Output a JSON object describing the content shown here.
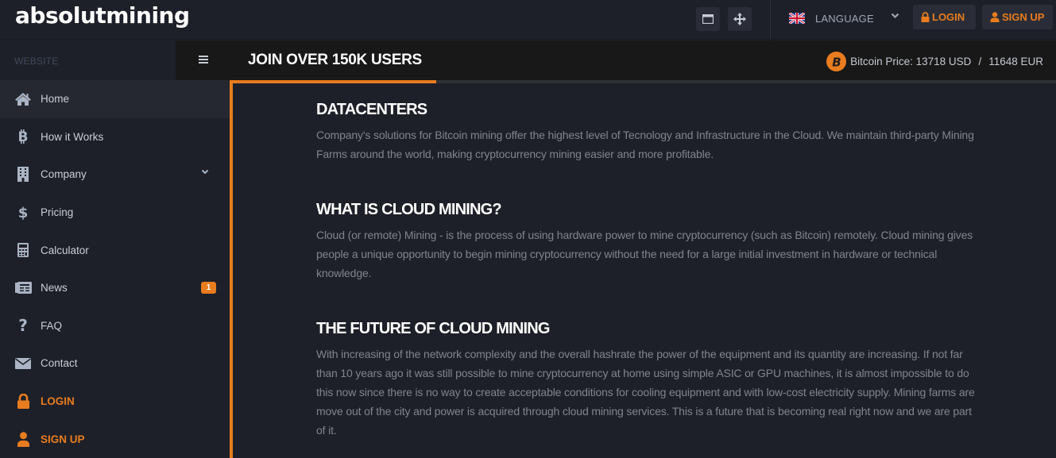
{
  "header": {
    "logo": "absolutmining",
    "window_button_icon": "window-icon",
    "move_button_icon": "move-arrows-icon",
    "language": {
      "flag": "uk-flag-icon",
      "label": "LANGUAGE"
    },
    "login_label": "LOGIN",
    "signup_label": "SIGN UP"
  },
  "sidebar": {
    "section_label": "WEBSITE",
    "items": [
      {
        "label": "Home",
        "icon": "home-icon",
        "active": true
      },
      {
        "label": "How it Works",
        "icon": "bitcoin-icon"
      },
      {
        "label": "Company",
        "icon": "building-icon",
        "has_submenu": true
      },
      {
        "label": "Pricing",
        "icon": "dollar-icon"
      },
      {
        "label": "Calculator",
        "icon": "calculator-icon"
      },
      {
        "label": "News",
        "icon": "newspaper-icon",
        "badge": "1"
      },
      {
        "label": "FAQ",
        "icon": "question-icon"
      },
      {
        "label": "Contact",
        "icon": "envelope-icon"
      },
      {
        "label": "LOGIN",
        "icon": "lock-icon",
        "accent": true
      },
      {
        "label": "SIGN UP",
        "icon": "user-icon",
        "accent": true
      }
    ]
  },
  "content_bar": {
    "title": "JOIN OVER 150K USERS",
    "bitcoin_price_label": "Bitcoin Price: 13718 USD",
    "separator": "/",
    "eur_price": "11648 EUR",
    "scroll_progress_fraction": 0.25
  },
  "main": {
    "sections": [
      {
        "heading": "DATACENTERS",
        "body": "Company's solutions for Bitcoin mining offer the highest level of Tecnology and Infrastructure in the Cloud. We maintain third-party Mining Farms around the world, making cryptocurrency mining easier and more profitable."
      },
      {
        "heading": "WHAT IS CLOUD MINING?",
        "body": "Cloud (or remote) Mining - is the process of using hardware power to mine cryptocurrency (such as Bitcoin) remotely. Cloud mining gives people a unique opportunity to begin mining cryptocurrency without the need for a large initial investment in hardware or technical knowledge."
      },
      {
        "heading": "THE FUTURE OF CLOUD MINING",
        "body": "With increasing of the network complexity and the overall hashrate the power of the equipment and its quantity are increasing. If not far than 10 years ago it was still possible to mine cryptocurrency at home using simple ASIC or GPU machines, it is almost impossible to do this now since there is no way to create acceptable conditions for cooling equipment and with low-cost electricity supply. Mining farms are move out of the city and power is acquired through cloud mining services. This is a future that is becoming real right now and we are part of it."
      }
    ]
  },
  "colors": {
    "accent": "#e87c1e",
    "background": "#1e2029",
    "bar_background": "#181818",
    "body_text": "#7f848e"
  }
}
